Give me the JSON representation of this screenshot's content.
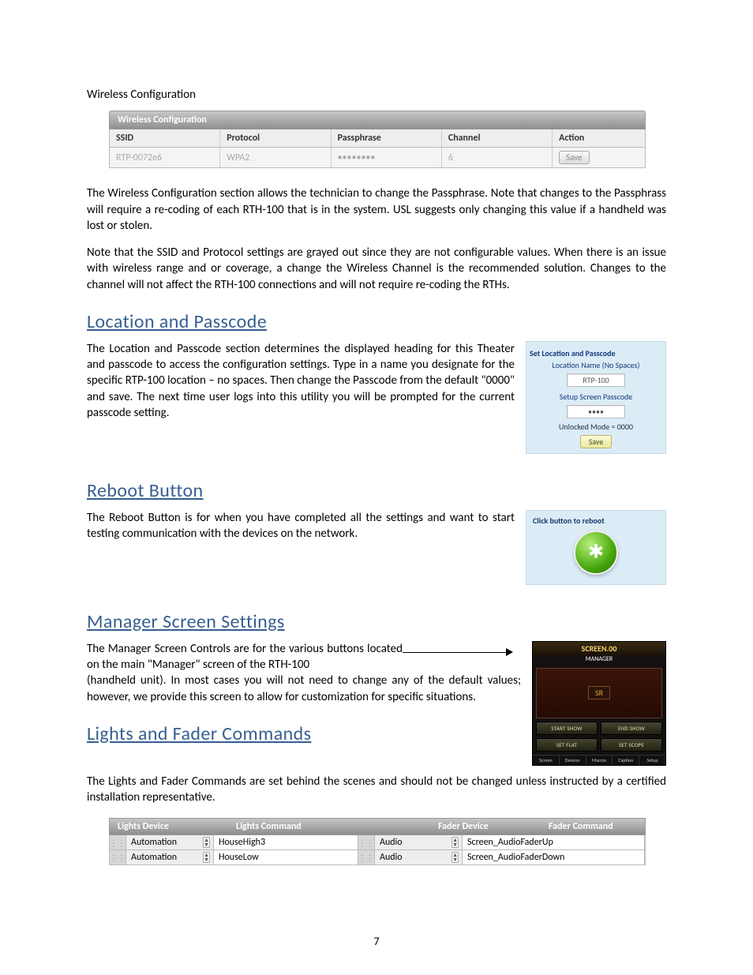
{
  "top_label": "Wireless Configuration",
  "wc": {
    "panel_title": "Wireless Configuration",
    "headers": {
      "ssid": "SSID",
      "protocol": "Protocol",
      "pass": "Passphrase",
      "channel": "Channel",
      "action": "Action"
    },
    "row": {
      "ssid": "RTP-0072e6",
      "protocol": "WPA2",
      "pass": "••••••••",
      "channel": "6",
      "action": "Save"
    }
  },
  "para1": "The Wireless Configuration section allows the technician to change the Passphrase. Note that changes to the Passphrass will require a re-coding of each RTH-100 that is in the system.  USL suggests only changing this value if a handheld was lost or stolen.",
  "para2": "Note that the SSID and Protocol settings are grayed out since they are not configurable values.  When there is an issue with wireless range and or coverage, a change the Wireless Channel is the recommended solution.  Changes to the channel will not affect the RTH-100 connections and will not require re-coding the RTHs.",
  "sec_loc_title": "Location and Passcode",
  "para_loc": "The Location and Passcode section determines the displayed heading for this Theater and passcode to access the configuration settings.  Type in a name you designate for the specific RTP-100 location – no spaces.  Then change the Passcode from the default \"0000\" and save.  The next time user logs into this utility you will be prompted for the current passcode setting.",
  "loc_panel": {
    "title": "Set Location and Passcode",
    "name_label": "Location Name (No Spaces)",
    "name_value": "RTP-100",
    "pass_label": "Setup Screen Passcode",
    "pass_value": "••••",
    "note": "Unlocked Mode = 0000",
    "save": "Save"
  },
  "sec_reboot_title": "Reboot Button",
  "para_reboot": "The Reboot Button is for when you have completed all the settings and want to start testing communication with the devices on the network.",
  "reboot_panel": {
    "title": "Click button to reboot"
  },
  "sec_mgr_title": "Manager Screen Settings",
  "para_mgr_a": "The Manager Screen Controls are for the various buttons located on the main \"Manager\" screen of the RTH-100",
  "para_mgr_b": "(handheld unit).  In most cases you will not need to change any of the default values; however, we provide this screen to allow for customization for specific situations.",
  "mgr_panel": {
    "screen": "SCREEN.00",
    "sub": "MANAGER",
    "sr": "SR",
    "btn1": "START SHOW",
    "btn2": "END SHOW",
    "btn3": "SET FLAT",
    "btn4": "SET SCOPE",
    "foot": [
      "Screen",
      "Devices",
      "Macros",
      "Caption",
      "Setup"
    ]
  },
  "sec_lf_title": "Lights and Fader Commands",
  "para_lf": "The Lights and Fader Commands are set behind the scenes and should not be changed unless instructed by a certified installation representative.",
  "lf": {
    "headers": {
      "ld": "Lights Device",
      "lc": "Lights Command",
      "fd": "Fader Device",
      "fc": "Fader Command"
    },
    "rows": [
      {
        "ld": "Automation",
        "lc": "HouseHigh3",
        "fd": "Audio",
        "fc": "Screen_AudioFaderUp"
      },
      {
        "ld": "Automation",
        "lc": "HouseLow",
        "fd": "Audio",
        "fc": "Screen_AudioFaderDown"
      }
    ]
  },
  "page_no": "7"
}
